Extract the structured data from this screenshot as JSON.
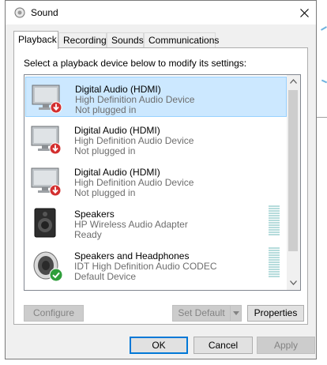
{
  "window": {
    "title": "Sound"
  },
  "tabs": [
    {
      "label": "Playback",
      "active": true
    },
    {
      "label": "Recording",
      "active": false
    },
    {
      "label": "Sounds",
      "active": false
    },
    {
      "label": "Communications",
      "active": false
    }
  ],
  "playback": {
    "instruction": "Select a playback device below to modify its settings:",
    "devices": [
      {
        "name": "Digital Audio (HDMI)",
        "driver": "High Definition Audio Device",
        "status": "Not plugged in",
        "icon": "monitor-icon",
        "badge": "unplugged-badge",
        "selected": true
      },
      {
        "name": "Digital Audio (HDMI)",
        "driver": "High Definition Audio Device",
        "status": "Not plugged in",
        "icon": "monitor-icon",
        "badge": "unplugged-badge",
        "selected": false
      },
      {
        "name": "Digital Audio (HDMI)",
        "driver": "High Definition Audio Device",
        "status": "Not plugged in",
        "icon": "monitor-icon",
        "badge": "unplugged-badge",
        "selected": false
      },
      {
        "name": "Speakers",
        "driver": "HP Wireless Audio Adapter",
        "status": "Ready",
        "icon": "speaker-box-icon",
        "badge": "",
        "selected": false
      },
      {
        "name": "Speakers and Headphones",
        "driver": "IDT High Definition Audio CODEC",
        "status": "Default Device",
        "icon": "speaker-round-icon",
        "badge": "default-check-badge",
        "selected": false
      }
    ],
    "buttons": {
      "configure": "Configure",
      "set_default": "Set Default",
      "properties": "Properties"
    }
  },
  "dialog_buttons": {
    "ok": "OK",
    "cancel": "Cancel",
    "apply": "Apply"
  },
  "colors": {
    "selection": "#cce8ff",
    "selection_border": "#99d1ff",
    "default_button_border": "#0078d7",
    "unplugged_badge": "#d32f2f",
    "default_badge": "#2e9e3a"
  }
}
